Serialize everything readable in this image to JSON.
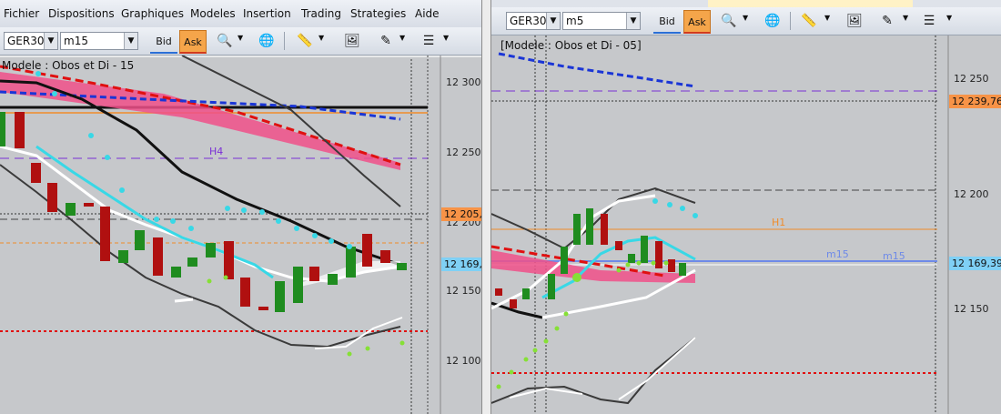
{
  "menu": [
    "Fichier",
    "Dispositions",
    "Graphiques",
    "Modeles",
    "Insertion",
    "Trading",
    "Strategies",
    "Aide"
  ],
  "left": {
    "instrument": "GER30",
    "timeframe": "m15",
    "bid_label": "Bid",
    "ask_label": "Ask",
    "title": "Modele : Obos et Di - 15",
    "h4_label": "H4",
    "price_ticks": [
      "12 300",
      "12 250",
      "12 200",
      "12 150",
      "12 100"
    ],
    "tag_orange": "12 205,",
    "tag_blue": "12 169,"
  },
  "right": {
    "instrument": "GER30",
    "timeframe": "m5",
    "bid_label": "Bid",
    "ask_label": "Ask",
    "title": "[Modele : Obos et Di - 05]",
    "h1_label": "H1",
    "m15_label_a": "m15",
    "m15_label_b": "m15",
    "price_ticks": [
      "12 250",
      "12 200",
      "12 150"
    ],
    "tag_orange": "12 239,76",
    "tag_blue": "12 169,39"
  },
  "colors": {
    "chart_bg": "#c6c8cb",
    "bull": "#1f8c1f",
    "bear": "#b01010",
    "tag_orange": "#f79347",
    "tag_blue": "#7fd0f5"
  },
  "icons": [
    "magnifier-icon",
    "globe-icon",
    "ruler-icon",
    "picture-icon",
    "drawing-tools-icon",
    "list-icon"
  ]
}
